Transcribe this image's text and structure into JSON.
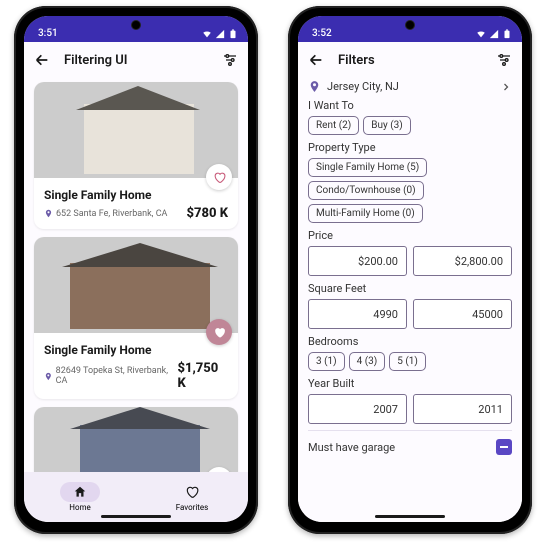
{
  "left": {
    "status_time": "3:51",
    "app_title": "Filtering UI",
    "listings": [
      {
        "title": "Single Family Home",
        "address": "652 Santa Fe, Riverbank, CA",
        "price": "$780 K",
        "favorited": false
      },
      {
        "title": "Single Family Home",
        "address": "82649 Topeka St, Riverbank, CA",
        "price": "$1,750 K",
        "favorited": true
      }
    ],
    "nav": {
      "home": "Home",
      "favorites": "Favorites"
    }
  },
  "right": {
    "status_time": "3:52",
    "app_title": "Filters",
    "location": "Jersey City, NJ",
    "i_want_to": {
      "label": "I Want To",
      "options": [
        "Rent (2)",
        "Buy (3)"
      ]
    },
    "property_type": {
      "label": "Property Type",
      "options": [
        "Single Family Home (5)",
        "Condo/Townhouse (0)",
        "Multi-Family Home (0)"
      ]
    },
    "price": {
      "label": "Price",
      "min": "$200.00",
      "max": "$2,800.00"
    },
    "square_feet": {
      "label": "Square Feet",
      "min": "4990",
      "max": "45000"
    },
    "bedrooms": {
      "label": "Bedrooms",
      "options": [
        "3 (1)",
        "4 (3)",
        "5 (1)"
      ]
    },
    "year_built": {
      "label": "Year Built",
      "min": "2007",
      "max": "2011"
    },
    "garage": {
      "label": "Must have garage",
      "enabled": true
    }
  }
}
